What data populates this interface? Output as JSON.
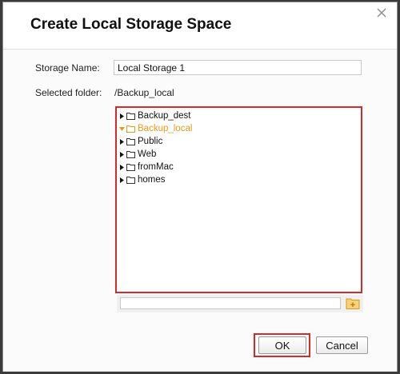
{
  "dialog": {
    "title": "Create Local Storage Space"
  },
  "form": {
    "storage_name_label": "Storage Name:",
    "storage_name_value": "Local Storage 1",
    "selected_folder_label": "Selected folder:",
    "selected_folder_value": "/Backup_local"
  },
  "tree": {
    "items": [
      {
        "label": "Backup_dest",
        "selected": false,
        "icon": "folder-icon"
      },
      {
        "label": "Backup_local",
        "selected": true,
        "icon": "folder-icon"
      },
      {
        "label": "Public",
        "selected": false,
        "icon": "folder-icon"
      },
      {
        "label": "Web",
        "selected": false,
        "icon": "folder-icon"
      },
      {
        "label": "fromMac",
        "selected": false,
        "icon": "folder-icon"
      },
      {
        "label": "homes",
        "selected": false,
        "icon": "folder-icon"
      }
    ]
  },
  "path_bar": {
    "value": "",
    "new_folder_icon": "new-folder-icon"
  },
  "buttons": {
    "ok_label": "OK",
    "cancel_label": "Cancel"
  },
  "colors": {
    "highlight_outline": "#d32a2a",
    "selected_item": "#e89a1c"
  }
}
